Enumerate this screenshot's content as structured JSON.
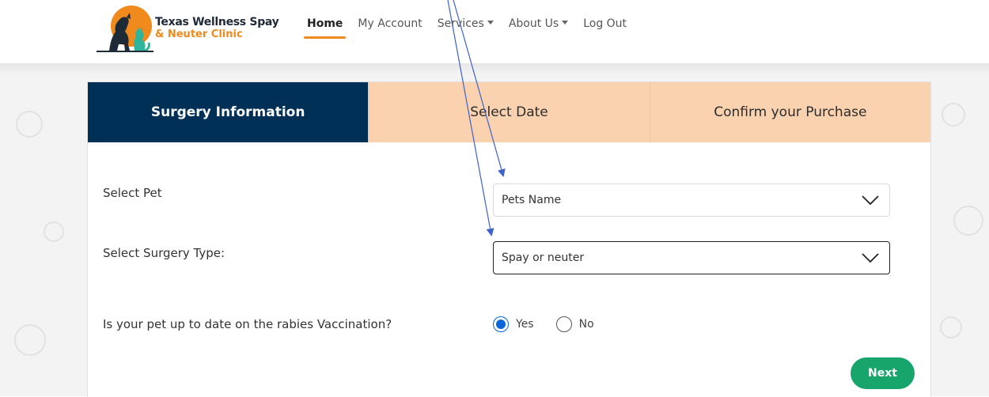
{
  "brand": {
    "line1": "Texas Wellness Spay",
    "line2": "& Neuter Clinic"
  },
  "nav": [
    {
      "label": "Home",
      "active": true,
      "dropdown": false
    },
    {
      "label": "My Account",
      "active": false,
      "dropdown": false
    },
    {
      "label": "Services",
      "active": false,
      "dropdown": true
    },
    {
      "label": "About Us",
      "active": false,
      "dropdown": true
    },
    {
      "label": "Log Out",
      "active": false,
      "dropdown": false
    }
  ],
  "steps": [
    {
      "label": "Surgery Information",
      "active": true
    },
    {
      "label": "Select Date",
      "active": false
    },
    {
      "label": "Confirm your Purchase",
      "active": false
    }
  ],
  "form": {
    "pet_label": "Select Pet",
    "pet_value": "Pets Name",
    "surgery_label": "Select Surgery Type:",
    "surgery_value": "Spay or neuter",
    "rabies_question": "Is your pet up to date on the rabies Vaccination?",
    "rabies_options": [
      {
        "label": "Yes",
        "checked": true
      },
      {
        "label": "No",
        "checked": false
      }
    ],
    "next_label": "Next"
  },
  "colors": {
    "active_step": "#013057",
    "inactive_step": "#fbd2b0",
    "accent_orange": "#f08a1c",
    "next_button": "#17a56b",
    "annotation_arrow": "#3d62c8"
  },
  "icons": [
    "dog-cat-logo-icon",
    "chevron-down-icon",
    "caret-down-icon"
  ]
}
